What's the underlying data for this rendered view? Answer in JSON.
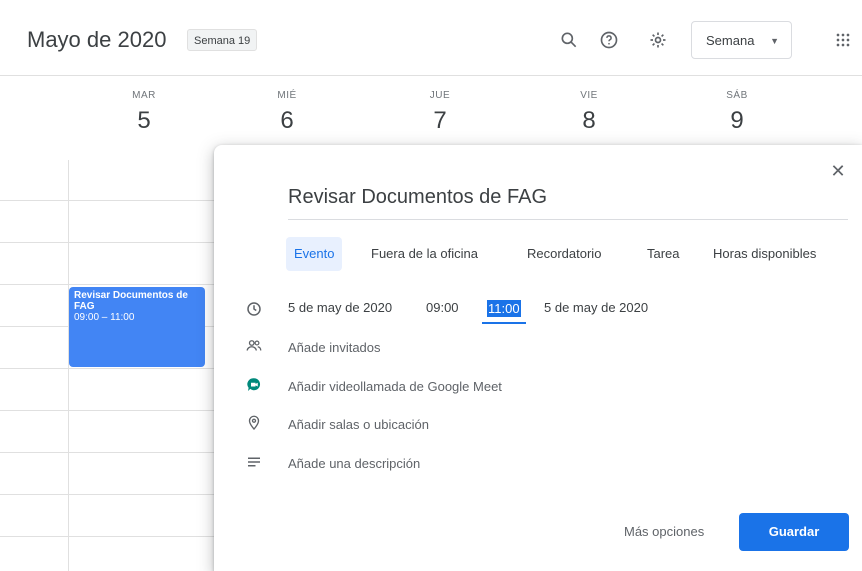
{
  "header": {
    "month_title": "Mayo de 2020",
    "week_label": "Semana 19",
    "view_select": "Semana"
  },
  "days": [
    {
      "name": "MAR",
      "num": "5"
    },
    {
      "name": "MIÉ",
      "num": "6"
    },
    {
      "name": "JUE",
      "num": "7"
    },
    {
      "name": "VIE",
      "num": "8"
    },
    {
      "name": "SÁB",
      "num": "9"
    }
  ],
  "event": {
    "title": "Revisar Documentos de FAG",
    "time": "09:00 – 11:00",
    "color": "#4285f4"
  },
  "dialog": {
    "title": "Revisar Documentos de FAG",
    "tabs": [
      {
        "label": "Evento",
        "active": true
      },
      {
        "label": "Fuera de la oficina"
      },
      {
        "label": "Recordatorio"
      },
      {
        "label": "Tarea"
      },
      {
        "label": "Horas disponibles"
      }
    ],
    "start_date": "5 de may de 2020",
    "start_time": "09:00",
    "end_time": "11:00",
    "end_date": "5 de may de 2020",
    "guests": "Añade invitados",
    "meet": "Añadir videollamada de Google Meet",
    "location": "Añadir salas o ubicación",
    "description": "Añade una descripción",
    "more_options": "Más opciones",
    "save": "Guardar"
  },
  "icons": [
    "search-icon",
    "help-icon",
    "settings-icon",
    "apps-icon",
    "close-icon",
    "clock-icon",
    "people-icon",
    "meet-icon",
    "location-icon",
    "description-icon"
  ],
  "colors": {
    "accent": "#1a73e8",
    "meet_green": "#00897b"
  }
}
